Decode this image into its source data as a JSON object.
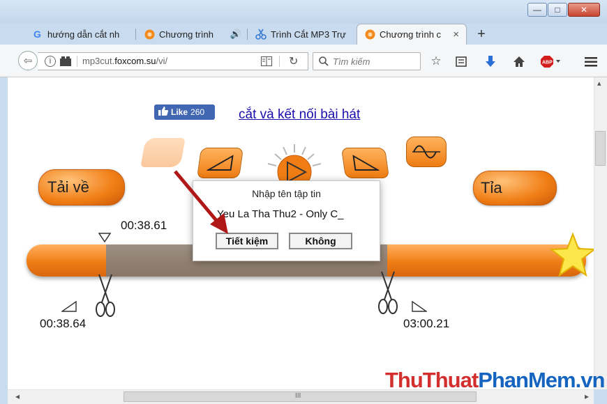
{
  "window": {
    "minimize": "—",
    "maximize": "□",
    "close": "✕"
  },
  "tabs": [
    {
      "label": "hướng dẫn cắt nh",
      "icon": "google-icon"
    },
    {
      "label": "Chương trình",
      "icon": "mp3cut-icon",
      "audio": "🔊"
    },
    {
      "label": "Trình Cắt MP3 Trự",
      "icon": "scissors-icon"
    },
    {
      "label": "Chương trình c",
      "icon": "mp3cut-icon",
      "close": "×"
    }
  ],
  "new_tab": "+",
  "nav": {
    "url_domain": "mp3cut.",
    "url_host": "foxcom.su",
    "url_path": "/vi/",
    "search_placeholder": "Tìm kiếm"
  },
  "page": {
    "like_label": "Like",
    "like_count": "260",
    "link_text": "cắt và kết nối bài hát",
    "download_label": "Tải về",
    "trim_label": "Tỉa",
    "time_cursor": "00:38.61",
    "time_start": "00:38.64",
    "time_end": "03:00.21"
  },
  "dialog": {
    "title": "Nhập tên tập tin",
    "filename": "Yeu La Tha Thu2 - Only C_",
    "save_label": "Tiết kiệm",
    "cancel_label": "Không"
  },
  "watermark": {
    "part1": "ThuThuat",
    "part2": "PhanMem",
    "part3": ".vn"
  },
  "scroll": {
    "left": "◂",
    "right": "▸",
    "up": "▴",
    "grip": "III"
  },
  "colors": {
    "accent_orange": "#f07d14",
    "link": "#1a0dab",
    "watermark_red": "#d32f2f",
    "watermark_blue": "#1565c0"
  }
}
